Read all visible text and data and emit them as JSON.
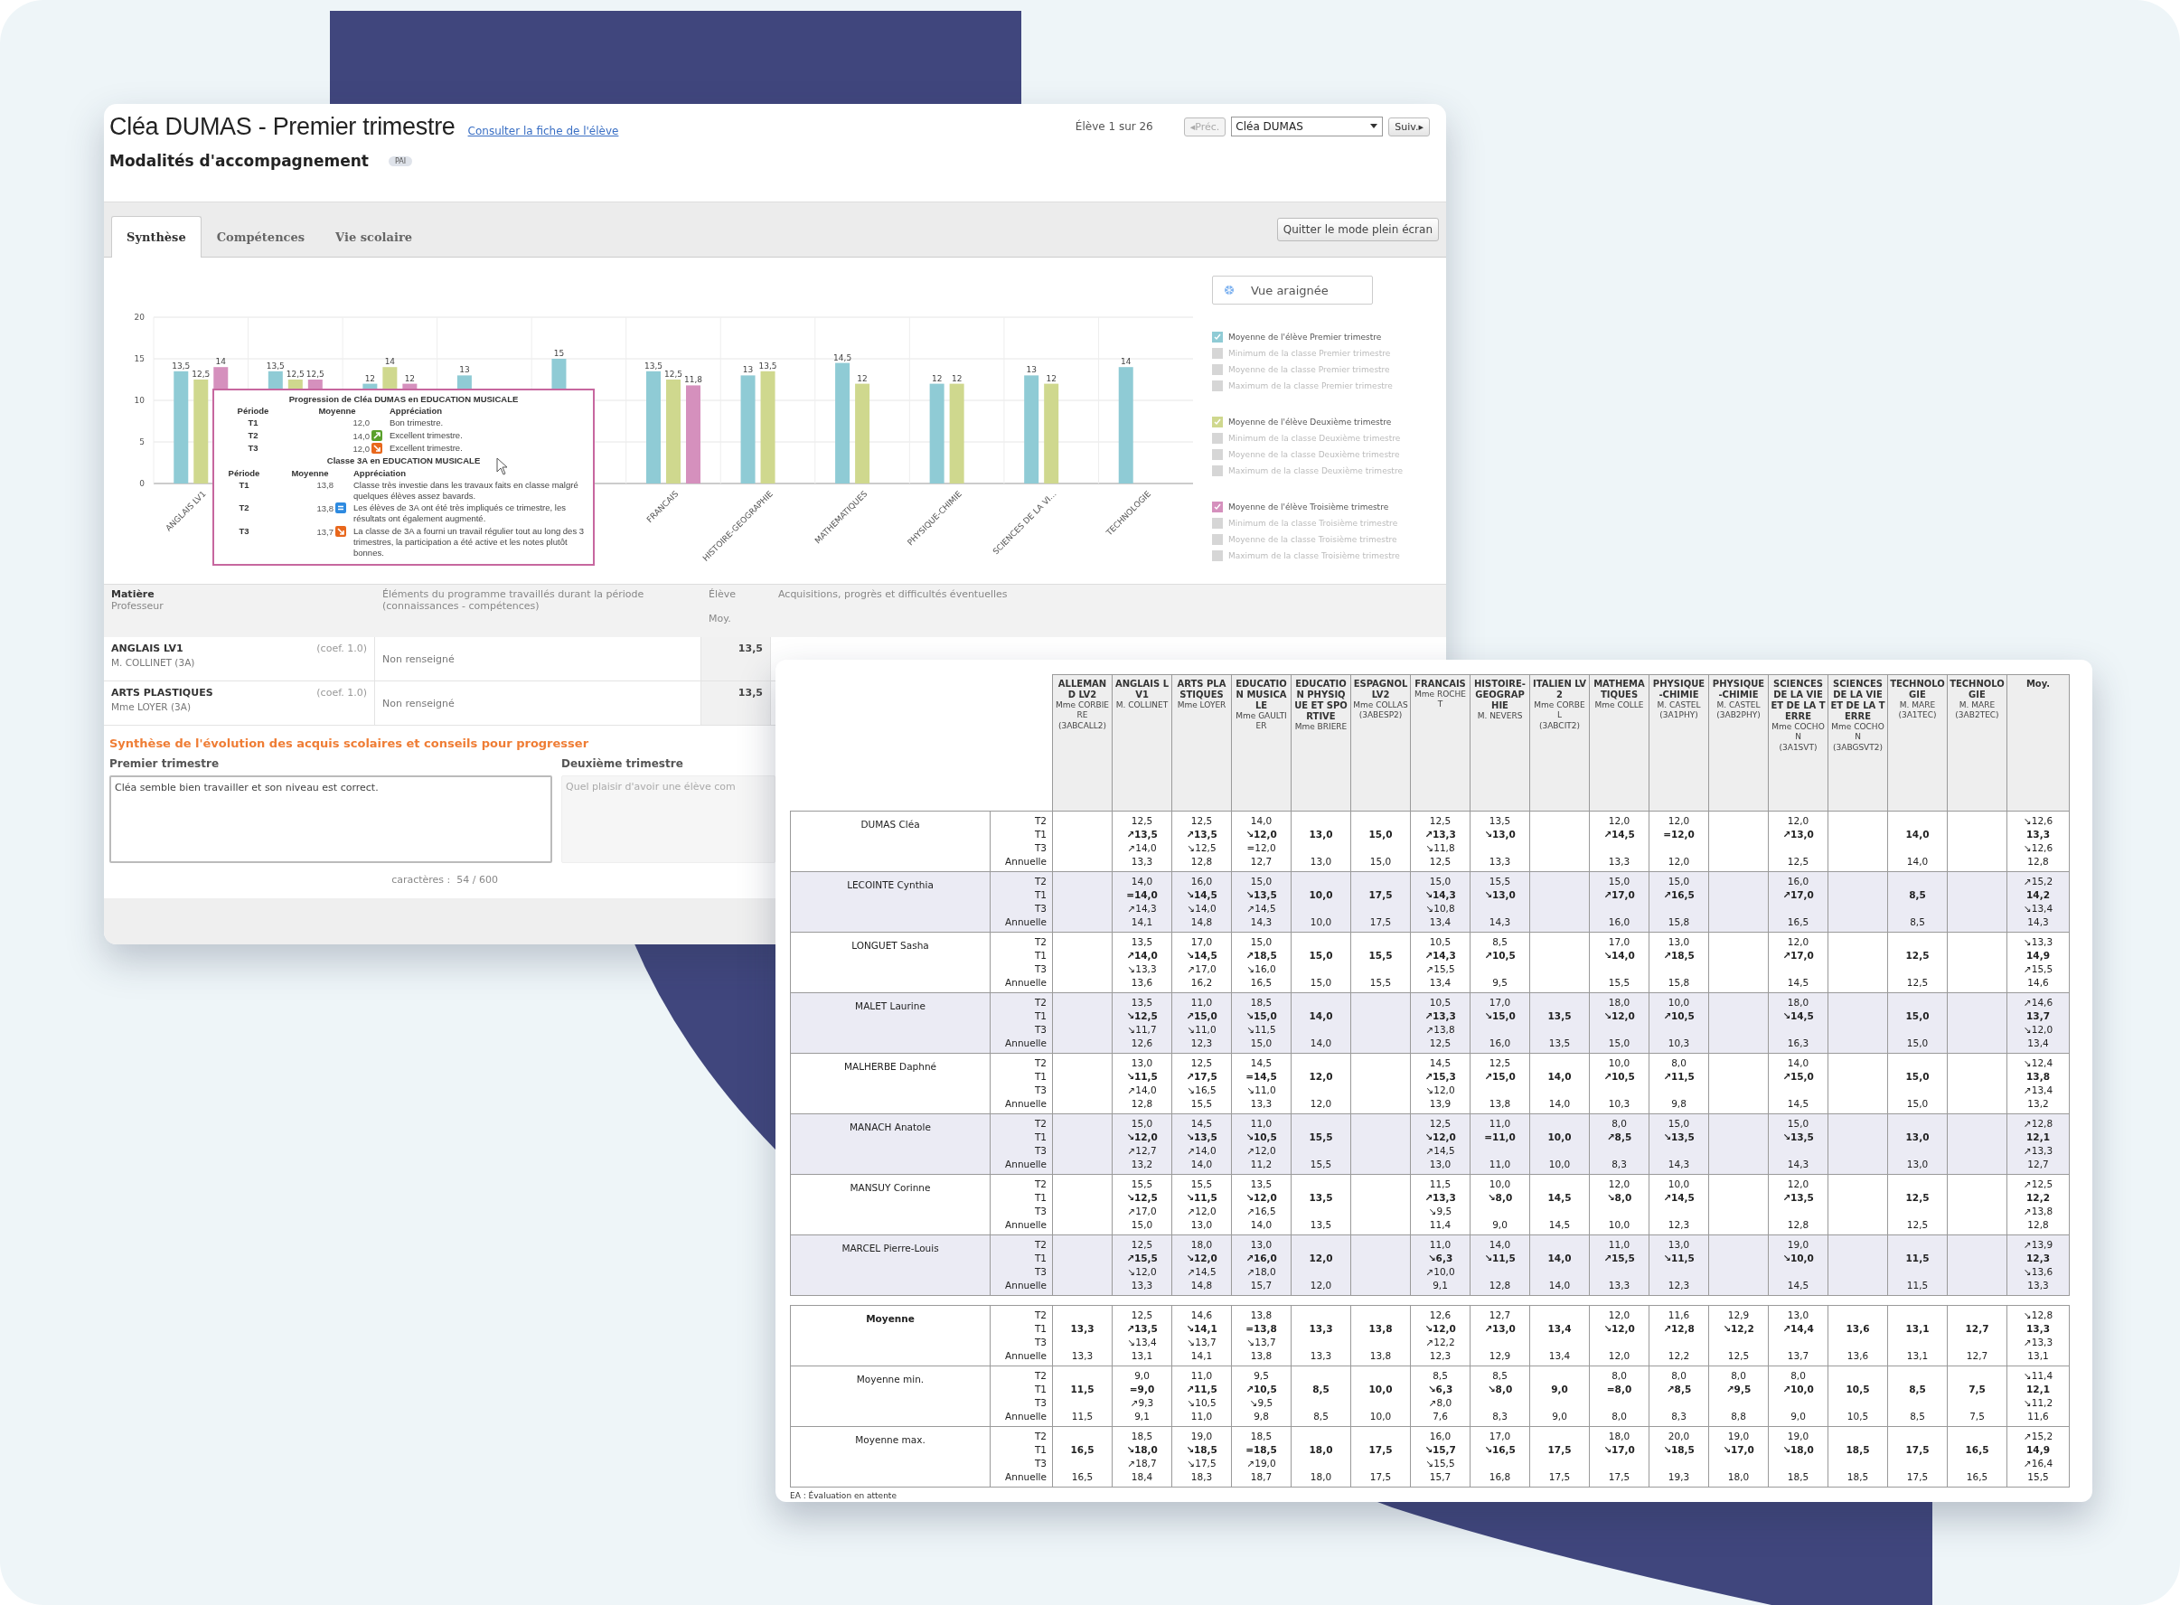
{
  "window": {
    "title": "Cléa DUMAS - Premier trimestre",
    "profile_link": "Consulter la fiche de l'élève",
    "counter": "Élève 1 sur 26",
    "prev_button": {
      "label": "◂Préc.",
      "disabled": true
    },
    "student_select": {
      "value": "Cléa DUMAS"
    },
    "next_button": {
      "label": "Suiv.▸",
      "disabled": false
    }
  },
  "support": {
    "label": "Modalités d'accompagnement",
    "badge": "PAI"
  },
  "tabs": [
    {
      "label": "Synthèse",
      "selected": true
    },
    {
      "label": "Compétences",
      "selected": false
    },
    {
      "label": "Vie scolaire",
      "selected": false
    }
  ],
  "fullscreen_button": "Quitter le mode plein écran",
  "spider_button": "Vue araignée",
  "chart": {
    "chart_data": {
      "type": "bar",
      "categories": [
        "ANGLAIS LV1",
        null,
        null,
        null,
        null,
        "FRANCAIS",
        "HISTOIRE-GEOGRAPHIE",
        "MATHEMATIQUES",
        "PHYSIQUE-CHIMIE",
        "SCIENCES DE LA VI...",
        "TECHNOLOGIE"
      ],
      "ylim": [
        0,
        20
      ],
      "yticks": [
        0,
        5,
        10,
        15,
        20
      ],
      "grid": true,
      "series": [
        {
          "name": "Moyenne de l'élève Premier trimestre",
          "color": "#8fcbd5",
          "values": [
            13.5,
            13.5,
            12,
            13,
            15,
            13.5,
            13,
            14.5,
            12,
            13,
            14
          ],
          "value_labels": [
            "13,5",
            "13,5",
            "12",
            "13",
            "15",
            "13,5",
            "13",
            "14,5",
            "12",
            "13",
            "14"
          ]
        },
        {
          "name": "Moyenne de l'élève Deuxième trimestre",
          "color": "#cfd88e",
          "values": [
            12.5,
            12.5,
            14,
            null,
            null,
            12.5,
            13.5,
            12,
            12,
            12,
            null
          ],
          "value_labels": [
            "12,5",
            "12,5",
            "14",
            null,
            null,
            "12,5",
            "13,5",
            "12",
            "12",
            "12",
            null
          ]
        },
        {
          "name": "Moyenne de l'élève Troisième trimestre",
          "color": "#d590bd",
          "values": [
            14,
            12.5,
            12,
            null,
            null,
            11.8,
            null,
            null,
            null,
            null,
            null
          ],
          "value_labels": [
            "14",
            "12,5",
            "12",
            null,
            null,
            "11,8",
            null,
            null,
            null,
            null,
            null
          ]
        }
      ]
    },
    "legend": [
      {
        "items": [
          {
            "kind": "series",
            "checked": true
          },
          {
            "kind": "class",
            "label": "Minimum de la classe Premier trimestre",
            "checked": false
          },
          {
            "kind": "class",
            "label": "Moyenne de la classe Premier trimestre",
            "checked": false
          },
          {
            "kind": "class",
            "label": "Maximum de la classe Premier trimestre",
            "checked": false
          }
        ]
      },
      {
        "items": [
          {
            "kind": "series",
            "checked": true
          },
          {
            "kind": "class",
            "label": "Minimum de la classe Deuxième trimestre",
            "checked": false
          },
          {
            "kind": "class",
            "label": "Moyenne de la classe Deuxième trimestre",
            "checked": false
          },
          {
            "kind": "class",
            "label": "Maximum de la classe Deuxième trimestre",
            "checked": false
          }
        ]
      },
      {
        "items": [
          {
            "kind": "series",
            "checked": true
          },
          {
            "kind": "class",
            "label": "Minimum de la classe Troisième trimestre",
            "checked": false
          },
          {
            "kind": "class",
            "label": "Moyenne de la classe Troisième trimestre",
            "checked": false
          },
          {
            "kind": "class",
            "label": "Maximum de la classe Troisième trimestre",
            "checked": false
          }
        ]
      }
    ]
  },
  "tooltip": {
    "sections": [
      {
        "title": "Progression de Cléa DUMAS en EDUCATION MUSICALE",
        "header": [
          "Période",
          "Moyenne",
          "Appréciation"
        ],
        "rows": [
          {
            "period": "T1",
            "average": "12,0",
            "kind": "plain",
            "comment": "Bon trimestre."
          },
          {
            "period": "T2",
            "average": "14,0",
            "kind": "up",
            "comment": "Excellent trimestre."
          },
          {
            "period": "T3",
            "average": "12,0",
            "kind": "down",
            "comment": "Excellent trimestre."
          }
        ]
      },
      {
        "title": "Classe 3A en EDUCATION MUSICALE",
        "header": [
          "Période",
          "Moyenne",
          "Appréciation"
        ],
        "rows": [
          {
            "period": "T1",
            "average": "13,8",
            "kind": "plain",
            "comment": "Classe très investie dans les travaux faits en classe malgré quelques élèves assez bavards."
          },
          {
            "period": "T2",
            "average": "13,8",
            "kind": "equal",
            "comment": "Les élèves de 3A ont été très impliqués ce trimestre, les résultats ont également augmenté."
          },
          {
            "period": "T3",
            "average": "13,7",
            "kind": "down",
            "comment": "La classe de 3A a fourni un travail régulier tout au long des 3 trimestres, la participation a été active et les notes plutôt bonnes."
          }
        ]
      }
    ]
  },
  "subjects_table": {
    "columns": [
      {
        "lines": [
          {
            "text": "Matière",
            "bold": true
          },
          {
            "text": "Professeur",
            "bold": false
          }
        ]
      },
      {
        "lines": [
          {
            "text": "Éléments du programme travaillés durant la période (connaissances - compétences)",
            "bold": false
          }
        ]
      },
      {
        "lines": [
          {
            "text": "Élève",
            "bold": false
          },
          {
            "text": "Moy.",
            "bold": false
          }
        ]
      },
      {
        "lines": [
          {
            "text": "Acquisitions, progrès et difficultés éventuelles",
            "bold": false
          }
        ]
      }
    ],
    "rows": [
      {
        "subject": "ANGLAIS LV1",
        "coef": "(coef. 1.0)",
        "teacher": "M. COLLINET (3A)",
        "program": "Non renseigné",
        "average": "13,5"
      },
      {
        "subject": "ARTS PLASTIQUES",
        "coef": "(coef. 1.0)",
        "teacher": "Mme LOYER (3A)",
        "program": "Non renseigné",
        "average": "13,5"
      }
    ]
  },
  "synthesis": {
    "title": "Synthèse de l'évolution des acquis scolaires et conseils pour progresser",
    "fields": [
      {
        "label": "Premier trimestre",
        "value": "Cléa semble bien travailler et son niveau est correct.",
        "disabled": false
      },
      {
        "label": "Deuxième trimestre",
        "value": "Quel plaisir d'avoir une élève com",
        "disabled": true
      }
    ],
    "counter": "caractères :  54 / 600"
  },
  "grades_table": {
    "columns": [
      {
        "subject": "ALLEMAND LV2",
        "teacher": "Mme CORBIERE",
        "group": "(3ABCALL2)"
      },
      {
        "subject": "ANGLAIS LV1",
        "teacher": "M. COLLINET"
      },
      {
        "subject": "ARTS PLASTIQUES",
        "teacher": "Mme LOYER"
      },
      {
        "subject": "EDUCATION MUSICALE",
        "teacher": "Mme GAULTIER"
      },
      {
        "subject": "EDUCATION PHYSIQUE ET SPORTIVE",
        "teacher": "Mme BRIERE"
      },
      {
        "subject": "ESPAGNOL LV2",
        "teacher": "Mme COLLAS",
        "group": "(3ABESP2)"
      },
      {
        "subject": "FRANCAIS",
        "teacher": "Mme ROCHET"
      },
      {
        "subject": "HISTOIRE-GEOGRAPHIE",
        "teacher": "M. NEVERS"
      },
      {
        "subject": "ITALIEN LV2",
        "teacher": "Mme CORBEL",
        "group": "(3ABCIT2)"
      },
      {
        "subject": "MATHEMATIQUES",
        "teacher": "Mme COLLE"
      },
      {
        "subject": "PHYSIQUE-CHIMIE",
        "teacher": "M. CASTEL",
        "group": "(3A1PHY)"
      },
      {
        "subject": "PHYSIQUE-CHIMIE",
        "teacher": "M. CASTEL",
        "group": "(3AB2PHY)"
      },
      {
        "subject": "SCIENCES DE LA VIE ET DE LA TERRE",
        "teacher": "Mme COCHON",
        "group": "(3A1SVT)"
      },
      {
        "subject": "SCIENCES DE LA VIE ET DE LA TERRE",
        "teacher": "Mme COCHON",
        "group": "(3ABGSVT2)"
      },
      {
        "subject": "TECHNOLOGIE",
        "teacher": "M. MARE",
        "group": "(3A1TEC)"
      },
      {
        "subject": "TECHNOLOGIE",
        "teacher": "M. MARE",
        "group": "(3AB2TEC)"
      },
      {
        "subject": "Moy."
      }
    ],
    "students": [
      {
        "name": "DUMAS Cléa",
        "periods": [
          "T2",
          "T1",
          "T3",
          "Annuelle"
        ],
        "cells": [
          null,
          [
            "12,5",
            "↗13,5",
            "↗14,0",
            "13,3"
          ],
          [
            "12,5",
            "↗13,5",
            "↘12,5",
            "12,8"
          ],
          [
            "14,0",
            "↘12,0",
            "=12,0",
            "12,7"
          ],
          [
            null,
            "13,0",
            null,
            "13,0"
          ],
          [
            null,
            "15,0",
            null,
            "15,0"
          ],
          [
            "12,5",
            "↗13,3",
            "↘11,8",
            "12,5"
          ],
          [
            "13,5",
            "↘13,0",
            null,
            "13,3"
          ],
          null,
          [
            "12,0",
            "↗14,5",
            null,
            "13,3"
          ],
          [
            "12,0",
            "=12,0",
            null,
            "12,0"
          ],
          null,
          [
            "12,0",
            "↗13,0",
            null,
            "12,5"
          ],
          null,
          [
            null,
            "14,0",
            null,
            "14,0"
          ],
          null,
          [
            "↘12,6",
            "13,3",
            "↘12,6",
            "12,8"
          ]
        ]
      },
      {
        "name": "LECOINTE Cynthia",
        "periods": [
          "T2",
          "T1",
          "T3",
          "Annuelle"
        ],
        "cells": [
          null,
          [
            "14,0",
            "=14,0",
            "↗14,3",
            "14,1"
          ],
          [
            "16,0",
            "↘14,5",
            "↘14,0",
            "14,8"
          ],
          [
            "15,0",
            "↘13,5",
            "↗14,5",
            "14,3"
          ],
          [
            null,
            "10,0",
            null,
            "10,0"
          ],
          [
            null,
            "17,5",
            null,
            "17,5"
          ],
          [
            "15,0",
            "↘14,3",
            "↘10,8",
            "13,4"
          ],
          [
            "15,5",
            "↘13,0",
            null,
            "14,3"
          ],
          null,
          [
            "15,0",
            "↗17,0",
            null,
            "16,0"
          ],
          [
            "15,0",
            "↗16,5",
            null,
            "15,8"
          ],
          null,
          [
            "16,0",
            "↗17,0",
            null,
            "16,5"
          ],
          null,
          [
            null,
            "8,5",
            null,
            "8,5"
          ],
          null,
          [
            "↗15,2",
            "14,2",
            "↘13,4",
            "14,3"
          ]
        ]
      },
      {
        "name": "LONGUET Sasha",
        "periods": [
          "T2",
          "T1",
          "T3",
          "Annuelle"
        ],
        "cells": [
          null,
          [
            "13,5",
            "↗14,0",
            "↘13,3",
            "13,6"
          ],
          [
            "17,0",
            "↘14,5",
            "↗17,0",
            "16,2"
          ],
          [
            "15,0",
            "↗18,5",
            "↘16,0",
            "16,5"
          ],
          [
            null,
            "15,0",
            null,
            "15,0"
          ],
          [
            null,
            "15,5",
            null,
            "15,5"
          ],
          [
            "10,5",
            "↗14,3",
            "↗15,5",
            "13,4"
          ],
          [
            "8,5",
            "↗10,5",
            null,
            "9,5"
          ],
          null,
          [
            "17,0",
            "↘14,0",
            null,
            "15,5"
          ],
          [
            "13,0",
            "↗18,5",
            null,
            "15,8"
          ],
          null,
          [
            "12,0",
            "↗17,0",
            null,
            "14,5"
          ],
          null,
          [
            null,
            "12,5",
            null,
            "12,5"
          ],
          null,
          [
            "↘13,3",
            "14,9",
            "↗15,5",
            "14,6"
          ]
        ]
      },
      {
        "name": "MALET Laurine",
        "periods": [
          "T2",
          "T1",
          "T3",
          "Annuelle"
        ],
        "cells": [
          null,
          [
            "13,5",
            "↘12,5",
            "↘11,7",
            "12,6"
          ],
          [
            "11,0",
            "↗15,0",
            "↘11,0",
            "12,3"
          ],
          [
            "18,5",
            "↘15,0",
            "↘11,5",
            "15,0"
          ],
          [
            null,
            "14,0",
            null,
            "14,0"
          ],
          null,
          [
            "10,5",
            "↗13,3",
            "↗13,8",
            "12,5"
          ],
          [
            "17,0",
            "↘15,0",
            null,
            "16,0"
          ],
          [
            null,
            "13,5",
            null,
            "13,5"
          ],
          [
            "18,0",
            "↘12,0",
            null,
            "15,0"
          ],
          [
            "10,0",
            "↗10,5",
            null,
            "10,3"
          ],
          null,
          [
            "18,0",
            "↘14,5",
            null,
            "16,3"
          ],
          null,
          [
            null,
            "15,0",
            null,
            "15,0"
          ],
          null,
          [
            "↗14,6",
            "13,7",
            "↘12,0",
            "13,4"
          ]
        ]
      },
      {
        "name": "MALHERBE Daphné",
        "periods": [
          "T2",
          "T1",
          "T3",
          "Annuelle"
        ],
        "cells": [
          null,
          [
            "13,0",
            "↘11,5",
            "↗14,0",
            "12,8"
          ],
          [
            "12,5",
            "↗17,5",
            "↘16,5",
            "15,5"
          ],
          [
            "14,5",
            "=14,5",
            "↘11,0",
            "13,3"
          ],
          [
            null,
            "12,0",
            null,
            "12,0"
          ],
          null,
          [
            "14,5",
            "↗15,3",
            "↘12,0",
            "13,9"
          ],
          [
            "12,5",
            "↗15,0",
            null,
            "13,8"
          ],
          [
            null,
            "14,0",
            null,
            "14,0"
          ],
          [
            "10,0",
            "↗10,5",
            null,
            "10,3"
          ],
          [
            "8,0",
            "↗11,5",
            null,
            "9,8"
          ],
          null,
          [
            "14,0",
            "↗15,0",
            null,
            "14,5"
          ],
          null,
          [
            null,
            "15,0",
            null,
            "15,0"
          ],
          null,
          [
            "↘12,4",
            "13,8",
            "↗13,4",
            "13,2"
          ]
        ]
      },
      {
        "name": "MANACH Anatole",
        "periods": [
          "T2",
          "T1",
          "T3",
          "Annuelle"
        ],
        "cells": [
          null,
          [
            "15,0",
            "↘12,0",
            "↗12,7",
            "13,2"
          ],
          [
            "14,5",
            "↘13,5",
            "↗14,0",
            "14,0"
          ],
          [
            "11,0",
            "↘10,5",
            "↗12,0",
            "11,2"
          ],
          [
            null,
            "15,5",
            null,
            "15,5"
          ],
          null,
          [
            "12,5",
            "↘12,0",
            "↗14,5",
            "13,0"
          ],
          [
            "11,0",
            "=11,0",
            null,
            "11,0"
          ],
          [
            null,
            "10,0",
            null,
            "10,0"
          ],
          [
            "8,0",
            "↗8,5",
            null,
            "8,3"
          ],
          [
            "15,0",
            "↘13,5",
            null,
            "14,3"
          ],
          null,
          [
            "15,0",
            "↘13,5",
            null,
            "14,3"
          ],
          null,
          [
            null,
            "13,0",
            null,
            "13,0"
          ],
          null,
          [
            "↗12,8",
            "12,1",
            "↗13,3",
            "12,7"
          ]
        ]
      },
      {
        "name": "MANSUY Corinne",
        "periods": [
          "T2",
          "T1",
          "T3",
          "Annuelle"
        ],
        "cells": [
          null,
          [
            "15,5",
            "↘12,5",
            "↗17,0",
            "15,0"
          ],
          [
            "15,5",
            "↘11,5",
            "↗12,0",
            "13,0"
          ],
          [
            "13,5",
            "↘12,0",
            "↗16,5",
            "14,0"
          ],
          [
            null,
            "13,5",
            null,
            "13,5"
          ],
          null,
          [
            "11,5",
            "↗13,3",
            "↘9,5",
            "11,4"
          ],
          [
            "10,0",
            "↘8,0",
            null,
            "9,0"
          ],
          [
            null,
            "14,5",
            null,
            "14,5"
          ],
          [
            "12,0",
            "↘8,0",
            null,
            "10,0"
          ],
          [
            "10,0",
            "↗14,5",
            null,
            "12,3"
          ],
          null,
          [
            "12,0",
            "↗13,5",
            null,
            "12,8"
          ],
          null,
          [
            null,
            "12,5",
            null,
            "12,5"
          ],
          null,
          [
            "↗12,5",
            "12,2",
            "↗13,8",
            "12,8"
          ]
        ]
      },
      {
        "name": "MARCEL Pierre-Louis",
        "periods": [
          "T2",
          "T1",
          "T3",
          "Annuelle"
        ],
        "cells": [
          null,
          [
            "12,5",
            "↗15,5",
            "↘12,0",
            "13,3"
          ],
          [
            "18,0",
            "↘12,0",
            "↗14,5",
            "14,8"
          ],
          [
            "13,0",
            "↗16,0",
            "↗18,0",
            "15,7"
          ],
          [
            null,
            "12,0",
            null,
            "12,0"
          ],
          null,
          [
            "11,0",
            "↘6,3",
            "↗10,0",
            "9,1"
          ],
          [
            "14,0",
            "↘11,5",
            null,
            "12,8"
          ],
          [
            null,
            "14,0",
            null,
            "14,0"
          ],
          [
            "11,0",
            "↗15,5",
            null,
            "13,3"
          ],
          [
            "13,0",
            "↘11,5",
            null,
            "12,3"
          ],
          null,
          [
            "19,0",
            "↘10,0",
            null,
            "14,5"
          ],
          null,
          [
            null,
            "11,5",
            null,
            "11,5"
          ],
          null,
          [
            "↗13,9",
            "12,3",
            "↘13,6",
            "13,3"
          ]
        ]
      }
    ],
    "summary": [
      {
        "name": "Moyenne",
        "bold": true,
        "periods": [
          "T2",
          "T1",
          "T3",
          "Annuelle"
        ],
        "cells": [
          [
            null,
            "13,3",
            null,
            "13,3"
          ],
          [
            "12,5",
            "↗13,5",
            "↘13,4",
            "13,1"
          ],
          [
            "14,6",
            "↘14,1",
            "↘13,7",
            "14,1"
          ],
          [
            "13,8",
            "=13,8",
            "↘13,7",
            "13,8"
          ],
          [
            null,
            "13,3",
            null,
            "13,3"
          ],
          [
            null,
            "13,8",
            null,
            "13,8"
          ],
          [
            "12,6",
            "↘12,0",
            "↗12,2",
            "12,3"
          ],
          [
            "12,7",
            "↗13,0",
            null,
            "12,9"
          ],
          [
            null,
            "13,4",
            null,
            "13,4"
          ],
          [
            "12,0",
            "↘12,0",
            null,
            "12,0"
          ],
          [
            "11,6",
            "↗12,8",
            null,
            "12,2"
          ],
          [
            "12,9",
            "↘12,2",
            null,
            "12,5"
          ],
          [
            "13,0",
            "↗14,4",
            null,
            "13,7"
          ],
          [
            null,
            "13,6",
            null,
            "13,6"
          ],
          [
            null,
            "13,1",
            null,
            "13,1"
          ],
          [
            null,
            "12,7",
            null,
            "12,7"
          ],
          [
            "↘12,8",
            "13,3",
            "↗13,3",
            "13,1"
          ]
        ]
      },
      {
        "name": "Moyenne min.",
        "bold": false,
        "periods": [
          "T2",
          "T1",
          "T3",
          "Annuelle"
        ],
        "cells": [
          [
            null,
            "11,5",
            null,
            "11,5"
          ],
          [
            "9,0",
            "=9,0",
            "↗9,3",
            "9,1"
          ],
          [
            "11,0",
            "↗11,5",
            "↘10,5",
            "11,0"
          ],
          [
            "9,5",
            "↗10,5",
            "↘9,5",
            "9,8"
          ],
          [
            null,
            "8,5",
            null,
            "8,5"
          ],
          [
            null,
            "10,0",
            null,
            "10,0"
          ],
          [
            "8,5",
            "↘6,3",
            "↗8,0",
            "7,6"
          ],
          [
            "8,5",
            "↘8,0",
            null,
            "8,3"
          ],
          [
            null,
            "9,0",
            null,
            "9,0"
          ],
          [
            "8,0",
            "=8,0",
            null,
            "8,0"
          ],
          [
            "8,0",
            "↗8,5",
            null,
            "8,3"
          ],
          [
            "8,0",
            "↗9,5",
            null,
            "8,8"
          ],
          [
            "8,0",
            "↗10,0",
            null,
            "9,0"
          ],
          [
            null,
            "10,5",
            null,
            "10,5"
          ],
          [
            null,
            "8,5",
            null,
            "8,5"
          ],
          [
            null,
            "7,5",
            null,
            "7,5"
          ],
          [
            "↘11,4",
            "12,1",
            "↘11,2",
            "11,6"
          ]
        ]
      },
      {
        "name": "Moyenne max.",
        "bold": false,
        "periods": [
          "T2",
          "T1",
          "T3",
          "Annuelle"
        ],
        "cells": [
          [
            null,
            "16,5",
            null,
            "16,5"
          ],
          [
            "18,5",
            "↘18,0",
            "↗18,7",
            "18,4"
          ],
          [
            "19,0",
            "↘18,5",
            "↘17,5",
            "18,3"
          ],
          [
            "18,5",
            "=18,5",
            "↗19,0",
            "18,7"
          ],
          [
            null,
            "18,0",
            null,
            "18,0"
          ],
          [
            null,
            "17,5",
            null,
            "17,5"
          ],
          [
            "16,0",
            "↘15,7",
            "↘15,5",
            "15,7"
          ],
          [
            "17,0",
            "↘16,5",
            null,
            "16,8"
          ],
          [
            null,
            "17,5",
            null,
            "17,5"
          ],
          [
            "18,0",
            "↘17,0",
            null,
            "17,5"
          ],
          [
            "20,0",
            "↘18,5",
            null,
            "19,3"
          ],
          [
            "19,0",
            "↘17,0",
            null,
            "18,0"
          ],
          [
            "19,0",
            "↘18,0",
            null,
            "18,5"
          ],
          [
            null,
            "18,5",
            null,
            "18,5"
          ],
          [
            null,
            "17,5",
            null,
            "17,5"
          ],
          [
            null,
            "16,5",
            null,
            "16,5"
          ],
          [
            "↗15,2",
            "14,9",
            "↗16,4",
            "15,5"
          ]
        ]
      }
    ],
    "footnote": "EA : Évaluation en attente"
  }
}
